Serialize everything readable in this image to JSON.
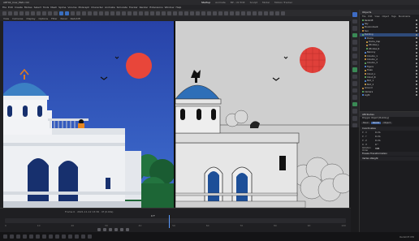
{
  "window": {
    "title": "ART02_Cow_Mstr.c4d"
  },
  "menu": [
    "File",
    "Edit",
    "Create",
    "Modes",
    "Select",
    "Tools",
    "Mesh",
    "Spline",
    "Volume",
    "MoGraph",
    "Character",
    "Animate",
    "Simulate",
    "Tracker",
    "Render",
    "Extensions",
    "Window",
    "Help"
  ],
  "layouts": {
    "items": [
      "Startup",
      "Animate",
      "BP - UV Edit",
      "Sculpt",
      "Model",
      "Motion Tracker"
    ],
    "active_index": 0
  },
  "viewport_menu": [
    "View",
    "Cameras",
    "Display",
    "Options",
    "Filter",
    "Panel",
    "Redshift"
  ],
  "timeline": {
    "readout": "Frame 0 · 2021-11-12 13:36 · 0f (0.00s)",
    "current_frame": "0 F",
    "ticks": [
      "0",
      "10",
      "20",
      "30",
      "40",
      "50",
      "60",
      "70",
      "80",
      "90",
      "100"
    ],
    "progress": 0.48
  },
  "status_text": "Redshift IPR",
  "objects": {
    "title": "Objects",
    "menu": [
      "File",
      "Edit",
      "View",
      "Object",
      "Tags",
      "Bookmarks"
    ],
    "rows": [
      "Redshift",
      "Sky",
      "Environment",
      "Sun",
      "Building",
      "Dome",
      "Dome_Cap",
      "Window_L",
      "Window_R",
      "Balcony",
      "Column_1",
      "Column_2",
      "Column_3",
      "Figure",
      "Trees",
      "Cloud_L",
      "Cloud_R",
      "Bird_1",
      "Bird_2",
      "Ground",
      "Camera",
      "Light"
    ],
    "selected_index": 4
  },
  "attributes": {
    "title": "Attributes",
    "tabs": [
      "Basic",
      "Coord.",
      "Object"
    ],
    "active_tab": 1,
    "object_line": "Polygon Object [Building]",
    "coord_section": "Coordinates",
    "fields": [
      {
        "label": "P . X",
        "value": "0 cm"
      },
      {
        "label": "P . Y",
        "value": "0 cm"
      },
      {
        "label": "P . Z",
        "value": "0 cm"
      },
      {
        "label": "R . H",
        "value": "0 °"
      }
    ],
    "order_label": "Rotation Order",
    "order_value": "HPB",
    "section2": "Freeze Transformation",
    "section3": "Vertex Weight"
  },
  "colors": {
    "sky": "#2846a6",
    "sun": "#e8463a",
    "dome": "#3b80c4",
    "building": "#e9ecef",
    "tree": "#1f6b3a",
    "accent": "#5a9bff"
  }
}
